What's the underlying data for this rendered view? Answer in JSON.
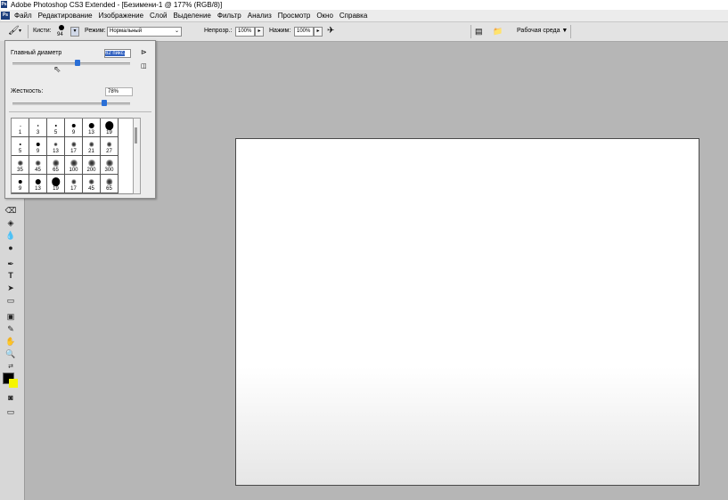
{
  "window": {
    "title": "Adobe Photoshop CS3 Extended - [Безимени-1 @ 177% (RGB/8)]",
    "app_badge": "Ps"
  },
  "menu": [
    "Файл",
    "Редактирование",
    "Изображение",
    "Слой",
    "Выделение",
    "Фильтр",
    "Анализ",
    "Просмотр",
    "Окно",
    "Справка"
  ],
  "options": {
    "brushes_label": "Кисти:",
    "brush_size": "94",
    "mode_label": "Режим:",
    "mode_value": "Нормальный",
    "opacity_label": "Непрозр.:",
    "opacity_value": "100%",
    "flow_label": "Нажим:",
    "flow_value": "100%",
    "workspace_label": "Рабочая среда ▼"
  },
  "brush_panel": {
    "diameter_label": "Главный диаметр",
    "diameter_value": "62 пикс.",
    "diameter_level": 0.55,
    "hardness_label": "Жесткость:",
    "hardness_value": "78%",
    "hardness_level": 0.78,
    "presets": [
      [
        "1",
        "3",
        "5",
        "9",
        "13",
        "19"
      ],
      [
        "5",
        "9",
        "13",
        "17",
        "21",
        "27"
      ],
      [
        "35",
        "45",
        "65",
        "100",
        "200",
        "300"
      ],
      [
        "9",
        "13",
        "19",
        "17",
        "45",
        "65"
      ]
    ]
  }
}
